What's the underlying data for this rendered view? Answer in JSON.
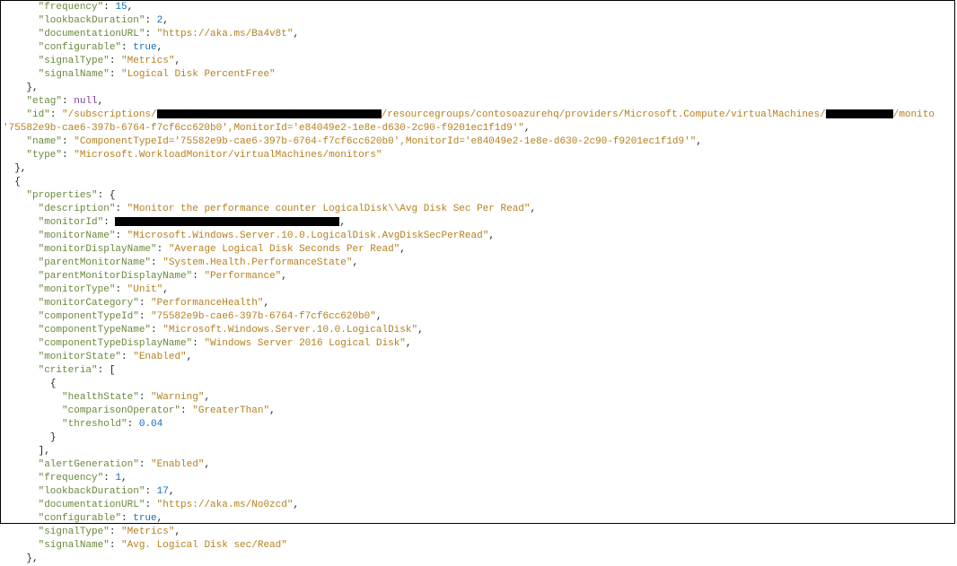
{
  "block1": {
    "frequency_key": "\"frequency\"",
    "frequency_val": "15",
    "lookback_key": "\"lookbackDuration\"",
    "lookback_val": "2",
    "docurl_key": "\"documentationURL\"",
    "docurl_val": "\"https://aka.ms/Ba4v8t\"",
    "configurable_key": "\"configurable\"",
    "configurable_val": "true",
    "signalType_key": "\"signalType\"",
    "signalType_val": "\"Metrics\"",
    "signalName_key": "\"signalName\"",
    "signalName_val": "\"Logical Disk PercentFree\""
  },
  "etag_key": "\"etag\"",
  "etag_val": "null",
  "id_key": "\"id\"",
  "id_val_pre": "\"/subscriptions/",
  "id_val_mid": "/resourcegroups/contosoazurehq/providers/Microsoft.Compute/virtualMachines/",
  "id_val_tail": "/monito",
  "id_line2": "'75582e9b-cae6-397b-6764-f7cf6cc620b0',MonitorId='e84049e2-1e8e-d630-2c90-f9201ec1f1d9'\"",
  "name_key": "\"name\"",
  "name_val": "\"ComponentTypeId='75582e9b-cae6-397b-6764-f7cf6cc620b0',MonitorId='e84049e2-1e8e-d630-2c90-f9201ec1f1d9'\"",
  "type_key": "\"type\"",
  "type_val": "\"Microsoft.WorkloadMonitor/virtualMachines/monitors\"",
  "block2": {
    "properties_key": "\"properties\"",
    "description_key": "\"description\"",
    "description_val": "\"Monitor the performance counter LogicalDisk\\\\Avg Disk Sec Per Read\"",
    "monitorId_key": "\"monitorId\"",
    "monitorName_key": "\"monitorName\"",
    "monitorName_val": "\"Microsoft.Windows.Server.10.0.LogicalDisk.AvgDiskSecPerRead\"",
    "monitorDisplayName_key": "\"monitorDisplayName\"",
    "monitorDisplayName_val": "\"Average Logical Disk Seconds Per Read\"",
    "parentMonitorName_key": "\"parentMonitorName\"",
    "parentMonitorName_val": "\"System.Health.PerformanceState\"",
    "parentMonitorDisplayName_key": "\"parentMonitorDisplayName\"",
    "parentMonitorDisplayName_val": "\"Performance\"",
    "monitorType_key": "\"monitorType\"",
    "monitorType_val": "\"Unit\"",
    "monitorCategory_key": "\"monitorCategory\"",
    "monitorCategory_val": "\"PerformanceHealth\"",
    "componentTypeId_key": "\"componentTypeId\"",
    "componentTypeId_val": "\"75582e9b-cae6-397b-6764-f7cf6cc620b0\"",
    "componentTypeName_key": "\"componentTypeName\"",
    "componentTypeName_val": "\"Microsoft.Windows.Server.10.0.LogicalDisk\"",
    "componentTypeDisplayName_key": "\"componentTypeDisplayName\"",
    "componentTypeDisplayName_val": "\"Windows Server 2016 Logical Disk\"",
    "monitorState_key": "\"monitorState\"",
    "monitorState_val": "\"Enabled\"",
    "criteria_key": "\"criteria\"",
    "healthState_key": "\"healthState\"",
    "healthState_val": "\"Warning\"",
    "comparisonOperator_key": "\"comparisonOperator\"",
    "comparisonOperator_val": "\"GreaterThan\"",
    "threshold_key": "\"threshold\"",
    "threshold_val": "0.04",
    "alertGeneration_key": "\"alertGeneration\"",
    "alertGeneration_val": "\"Enabled\"",
    "frequency_key": "\"frequency\"",
    "frequency_val": "1",
    "lookback_key": "\"lookbackDuration\"",
    "lookback_val": "17",
    "docurl_key": "\"documentationURL\"",
    "docurl_val": "\"https://aka.ms/No0zcd\"",
    "configurable_key": "\"configurable\"",
    "configurable_val": "true",
    "signalType_key": "\"signalType\"",
    "signalType_val": "\"Metrics\"",
    "signalName_key": "\"signalName\"",
    "signalName_val": "\"Avg. Logical Disk sec/Read\""
  }
}
